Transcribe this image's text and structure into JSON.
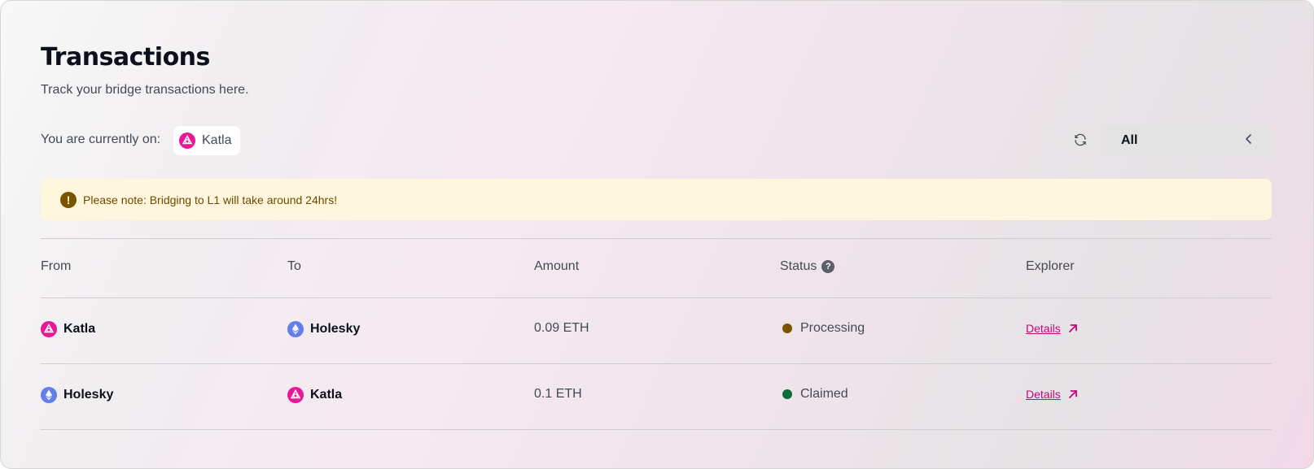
{
  "header": {
    "title": "Transactions",
    "subtitle": "Track your bridge transactions here."
  },
  "network": {
    "label": "You are currently on:",
    "current": "Katla",
    "current_icon": "katla-icon"
  },
  "controls": {
    "refresh_icon": "refresh-icon",
    "filter_value": "All",
    "filter_icon": "chevron-left-icon"
  },
  "notice": {
    "icon": "exclamation-icon",
    "text": "Please note: Bridging to L1 will take around 24hrs!"
  },
  "table": {
    "columns": [
      "From",
      "To",
      "Amount",
      "Status",
      "Explorer"
    ],
    "status_help_icon": "help-icon",
    "rows": [
      {
        "from": "Katla",
        "from_icon": "katla-icon",
        "to": "Holesky",
        "to_icon": "ethereum-icon",
        "amount": "0.09 ETH",
        "status": "Processing",
        "status_color": "#7a5300",
        "explorer": "Details"
      },
      {
        "from": "Holesky",
        "from_icon": "ethereum-icon",
        "to": "Katla",
        "to_icon": "katla-icon",
        "amount": "0.1 ETH",
        "status": "Claimed",
        "status_color": "#0b6b3a",
        "explorer": "Details"
      }
    ]
  },
  "colors": {
    "accent": "#c8047d",
    "katla_brand": "#e81899",
    "ethereum": "#627eea",
    "notice_bg": "#fff6dd"
  }
}
